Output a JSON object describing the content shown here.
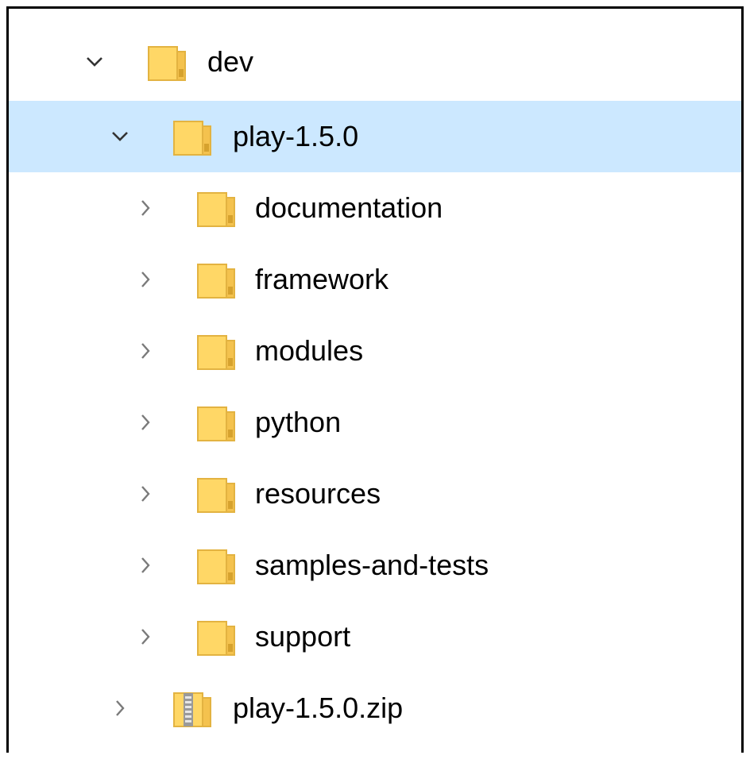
{
  "tree": {
    "root": {
      "label": "dev",
      "expanded": true,
      "icon": "folder-icon"
    },
    "project": {
      "label": "play-1.5.0",
      "expanded": true,
      "selected": true,
      "icon": "folder-icon"
    },
    "children": [
      {
        "label": "documentation",
        "icon": "folder-icon"
      },
      {
        "label": "framework",
        "icon": "folder-icon"
      },
      {
        "label": "modules",
        "icon": "folder-icon"
      },
      {
        "label": "python",
        "icon": "folder-icon"
      },
      {
        "label": "resources",
        "icon": "folder-icon"
      },
      {
        "label": "samples-and-tests",
        "icon": "folder-icon"
      },
      {
        "label": "support",
        "icon": "folder-icon"
      }
    ],
    "archive": {
      "label": "play-1.5.0.zip",
      "icon": "zip-folder-icon"
    }
  },
  "colors": {
    "selection": "#cce8ff",
    "folder": "#ffd766",
    "folder_edge": "#e8b73c",
    "chevron": "#606060"
  }
}
